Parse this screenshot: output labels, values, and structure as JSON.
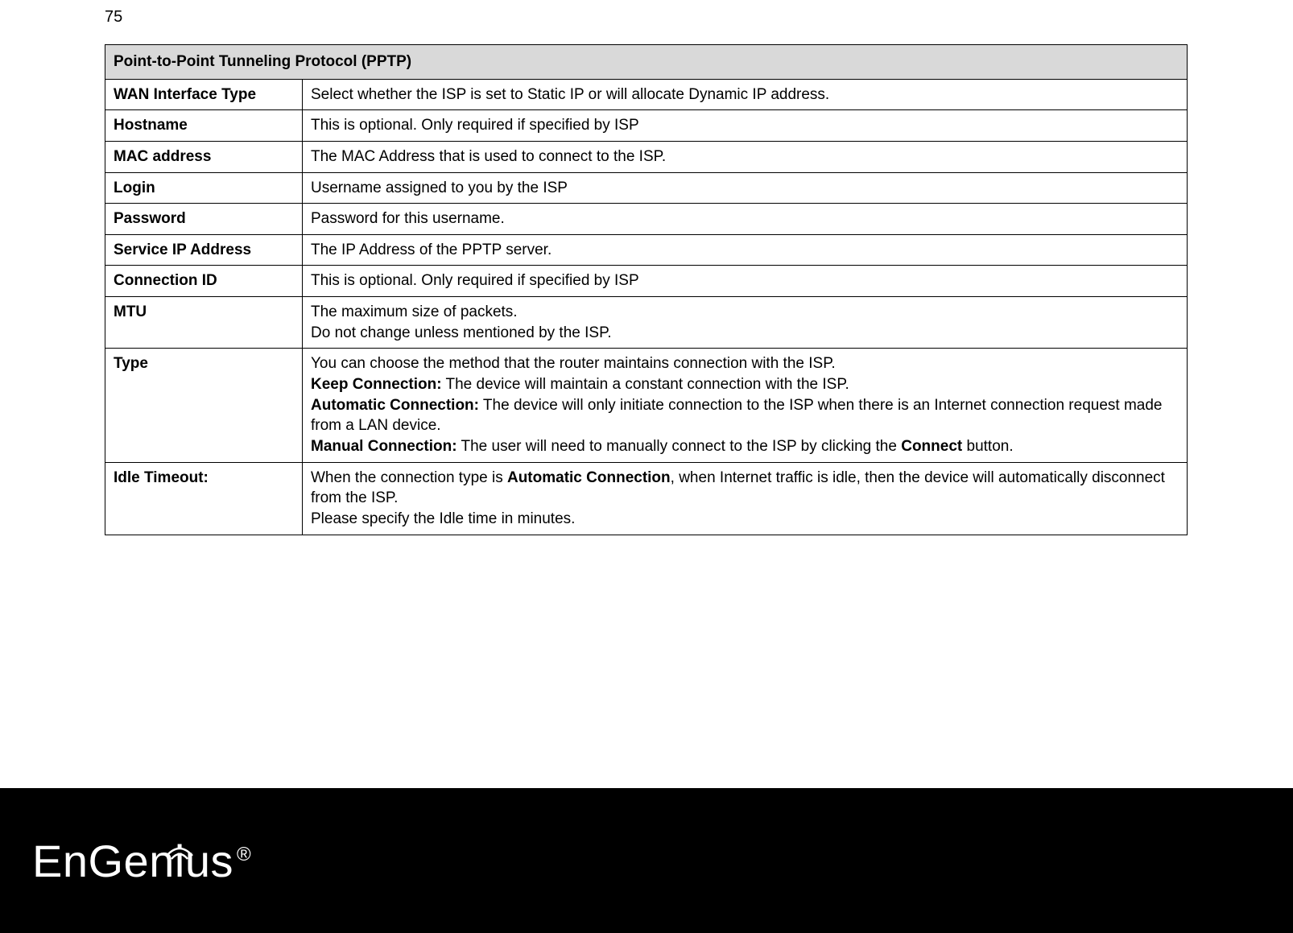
{
  "page_number": "75",
  "table": {
    "title": "Point-to-Point Tunneling Protocol (PPTP)",
    "rows": [
      {
        "label": "WAN Interface Type",
        "desc_html": "Select whether the ISP is set to Static IP or will allocate Dynamic IP address."
      },
      {
        "label": "Hostname",
        "desc_html": "This is optional. Only required if specified by ISP"
      },
      {
        "label": "MAC address",
        "desc_html": "The MAC Address that is used to connect to the ISP."
      },
      {
        "label": "Login",
        "desc_html": "Username assigned to you by the ISP"
      },
      {
        "label": "Password",
        "desc_html": "Password for this username."
      },
      {
        "label": "Service IP Address",
        "desc_html": "The IP Address of the PPTP server."
      },
      {
        "label": "Connection ID",
        "desc_html": "This is optional. Only required if specified by ISP"
      },
      {
        "label": "MTU",
        "desc_html": "The maximum size of packets.<br>Do not change unless mentioned by the ISP."
      },
      {
        "label": "Type",
        "desc_html": "You can choose the method that the router maintains connection with the ISP.<br><b>Keep Connection:</b> The device will maintain a constant connection with the ISP.<br><b>Automatic Connection:</b> The device will only initiate connection to the ISP when there is an Internet connection request made from a LAN device.<br><b>Manual Connection:</b> The user will need to manually connect to the ISP by clicking the <b>Connect</b> button."
      },
      {
        "label": "Idle Timeout:",
        "desc_html": "When the connection type is <b>Automatic Connection</b>, when Internet traffic is idle, then the device will automatically disconnect from the ISP.<br>Please specify the Idle time in minutes."
      }
    ]
  },
  "logo": {
    "text_en": "En",
    "text_gen": "Gen",
    "text_us": "us",
    "reg": "®"
  }
}
